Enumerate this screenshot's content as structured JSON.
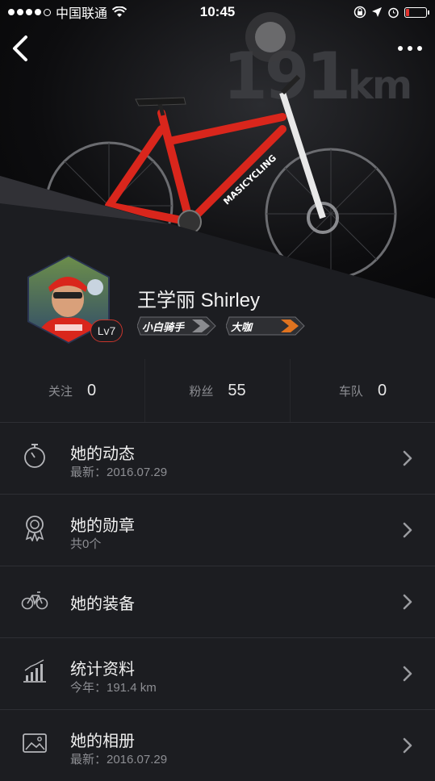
{
  "status_bar": {
    "carrier": "中国联通",
    "time": "10:45"
  },
  "hero": {
    "distance_value": "191",
    "distance_unit": "km",
    "bike_brand_text": "MASICYCLING"
  },
  "profile": {
    "name": "王学丽 Shirley",
    "level": "Lv7",
    "tags": [
      "小白骑手",
      "大咖"
    ]
  },
  "stats": [
    {
      "label": "关注",
      "value": "0"
    },
    {
      "label": "粉丝",
      "value": "55"
    },
    {
      "label": "车队",
      "value": "0"
    }
  ],
  "menu": [
    {
      "title": "她的动态",
      "subtitle": "最新：2016.07.29",
      "icon": "stopwatch-icon"
    },
    {
      "title": "她的勋章",
      "subtitle": "共0个",
      "icon": "medal-icon"
    },
    {
      "title": "她的装备",
      "subtitle": "",
      "icon": "bicycle-icon"
    },
    {
      "title": "统计资料",
      "subtitle": "今年：191.4 km",
      "icon": "bar-chart-icon"
    },
    {
      "title": "她的相册",
      "subtitle": "最新：2016.07.29",
      "icon": "photo-album-icon"
    }
  ],
  "colors": {
    "background": "#1c1d21",
    "accent_red": "#d9261c",
    "tag_arrow_1": "#8a8b8f",
    "tag_arrow_2": "#e0731f"
  }
}
